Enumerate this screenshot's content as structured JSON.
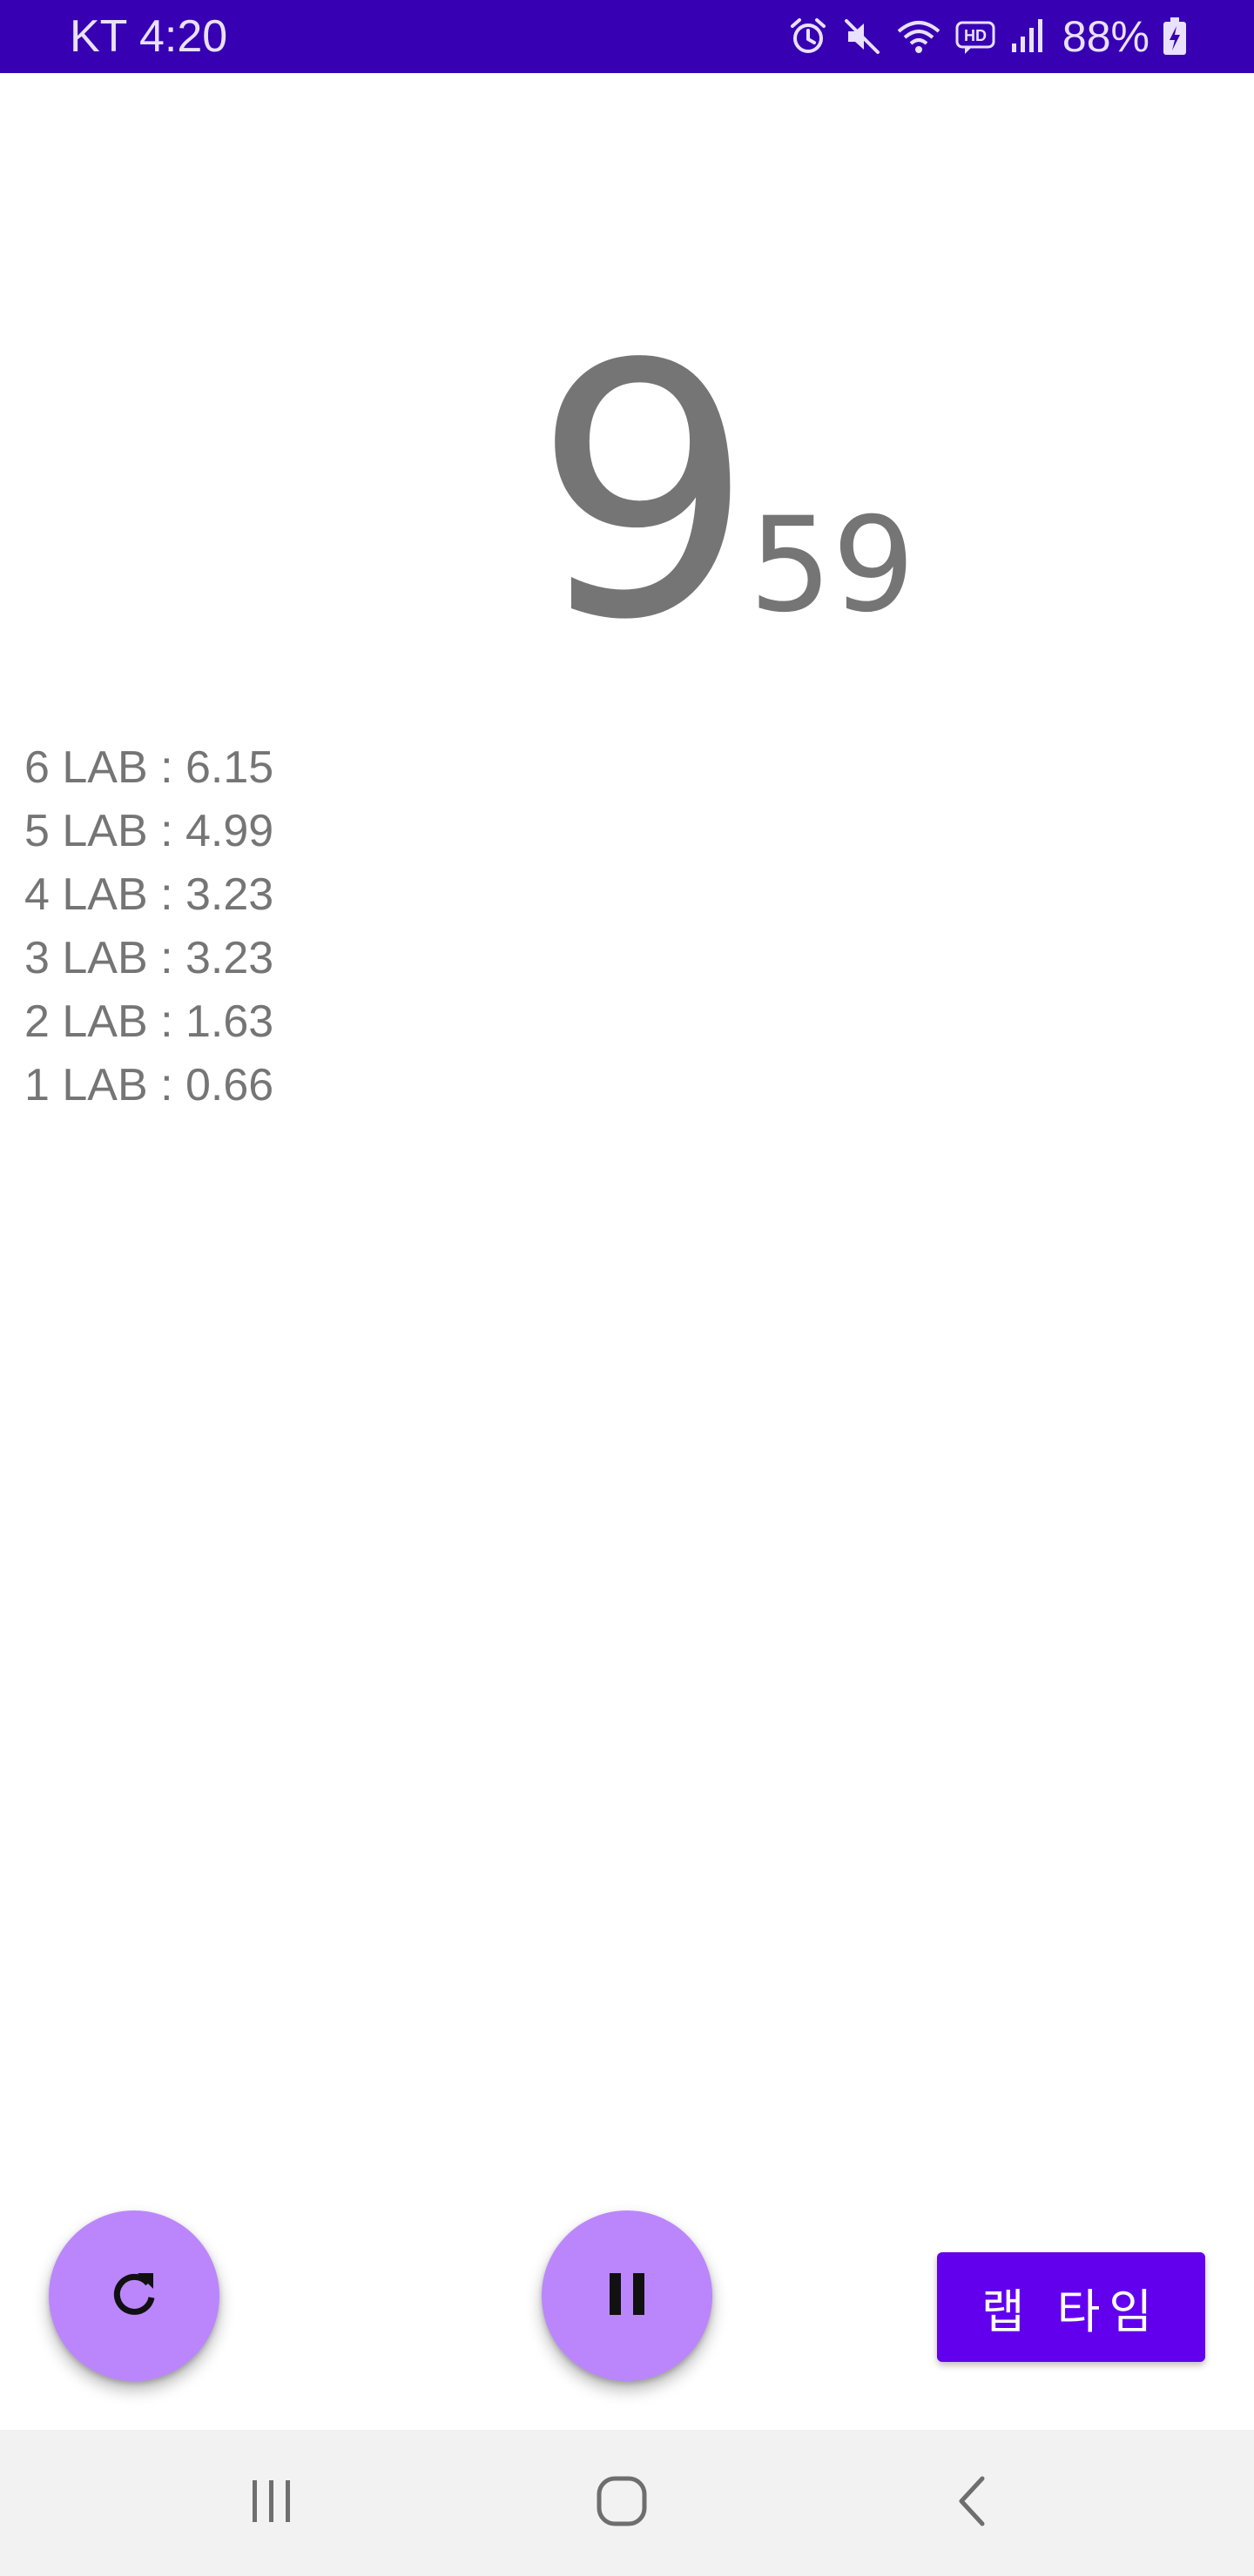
{
  "status_bar": {
    "carrier_time": "KT 4:20",
    "battery": "88%",
    "icons": [
      "alarm-icon",
      "mute-icon",
      "wifi-icon",
      "hd-icon",
      "signal-icon",
      "battery-icon"
    ],
    "background_color": "#3700b3"
  },
  "timer": {
    "seconds": "9",
    "hundredths": "59"
  },
  "laps": [
    {
      "text": "6 LAB : 6.15"
    },
    {
      "text": "5 LAB : 4.99"
    },
    {
      "text": "4 LAB : 3.23"
    },
    {
      "text": "3 LAB : 3.23"
    },
    {
      "text": "2 LAB : 1.63"
    },
    {
      "text": "1 LAB : 0.66"
    }
  ],
  "controls": {
    "reset_icon": "refresh-icon",
    "pause_icon": "pause-icon",
    "lap_label": "랩 타임",
    "fab_color": "#bb86fc",
    "lap_button_color": "#6200ee"
  },
  "nav": {
    "icons": [
      "recent-apps-icon",
      "home-icon",
      "back-icon"
    ]
  }
}
